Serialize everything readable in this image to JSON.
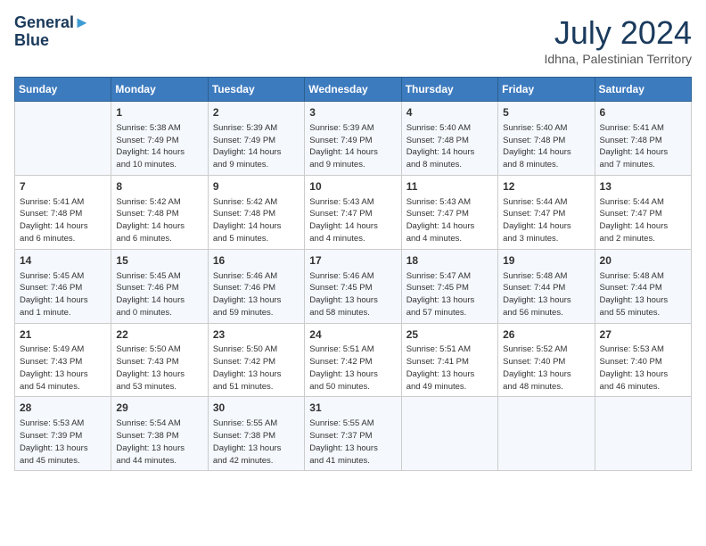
{
  "header": {
    "logo_line1": "General",
    "logo_line2": "Blue",
    "month_year": "July 2024",
    "location": "Idhna, Palestinian Territory"
  },
  "columns": [
    "Sunday",
    "Monday",
    "Tuesday",
    "Wednesday",
    "Thursday",
    "Friday",
    "Saturday"
  ],
  "weeks": [
    [
      {
        "day": "",
        "content": ""
      },
      {
        "day": "1",
        "content": "Sunrise: 5:38 AM\nSunset: 7:49 PM\nDaylight: 14 hours\nand 10 minutes."
      },
      {
        "day": "2",
        "content": "Sunrise: 5:39 AM\nSunset: 7:49 PM\nDaylight: 14 hours\nand 9 minutes."
      },
      {
        "day": "3",
        "content": "Sunrise: 5:39 AM\nSunset: 7:49 PM\nDaylight: 14 hours\nand 9 minutes."
      },
      {
        "day": "4",
        "content": "Sunrise: 5:40 AM\nSunset: 7:48 PM\nDaylight: 14 hours\nand 8 minutes."
      },
      {
        "day": "5",
        "content": "Sunrise: 5:40 AM\nSunset: 7:48 PM\nDaylight: 14 hours\nand 8 minutes."
      },
      {
        "day": "6",
        "content": "Sunrise: 5:41 AM\nSunset: 7:48 PM\nDaylight: 14 hours\nand 7 minutes."
      }
    ],
    [
      {
        "day": "7",
        "content": "Sunrise: 5:41 AM\nSunset: 7:48 PM\nDaylight: 14 hours\nand 6 minutes."
      },
      {
        "day": "8",
        "content": "Sunrise: 5:42 AM\nSunset: 7:48 PM\nDaylight: 14 hours\nand 6 minutes."
      },
      {
        "day": "9",
        "content": "Sunrise: 5:42 AM\nSunset: 7:48 PM\nDaylight: 14 hours\nand 5 minutes."
      },
      {
        "day": "10",
        "content": "Sunrise: 5:43 AM\nSunset: 7:47 PM\nDaylight: 14 hours\nand 4 minutes."
      },
      {
        "day": "11",
        "content": "Sunrise: 5:43 AM\nSunset: 7:47 PM\nDaylight: 14 hours\nand 4 minutes."
      },
      {
        "day": "12",
        "content": "Sunrise: 5:44 AM\nSunset: 7:47 PM\nDaylight: 14 hours\nand 3 minutes."
      },
      {
        "day": "13",
        "content": "Sunrise: 5:44 AM\nSunset: 7:47 PM\nDaylight: 14 hours\nand 2 minutes."
      }
    ],
    [
      {
        "day": "14",
        "content": "Sunrise: 5:45 AM\nSunset: 7:46 PM\nDaylight: 14 hours\nand 1 minute."
      },
      {
        "day": "15",
        "content": "Sunrise: 5:45 AM\nSunset: 7:46 PM\nDaylight: 14 hours\nand 0 minutes."
      },
      {
        "day": "16",
        "content": "Sunrise: 5:46 AM\nSunset: 7:46 PM\nDaylight: 13 hours\nand 59 minutes."
      },
      {
        "day": "17",
        "content": "Sunrise: 5:46 AM\nSunset: 7:45 PM\nDaylight: 13 hours\nand 58 minutes."
      },
      {
        "day": "18",
        "content": "Sunrise: 5:47 AM\nSunset: 7:45 PM\nDaylight: 13 hours\nand 57 minutes."
      },
      {
        "day": "19",
        "content": "Sunrise: 5:48 AM\nSunset: 7:44 PM\nDaylight: 13 hours\nand 56 minutes."
      },
      {
        "day": "20",
        "content": "Sunrise: 5:48 AM\nSunset: 7:44 PM\nDaylight: 13 hours\nand 55 minutes."
      }
    ],
    [
      {
        "day": "21",
        "content": "Sunrise: 5:49 AM\nSunset: 7:43 PM\nDaylight: 13 hours\nand 54 minutes."
      },
      {
        "day": "22",
        "content": "Sunrise: 5:50 AM\nSunset: 7:43 PM\nDaylight: 13 hours\nand 53 minutes."
      },
      {
        "day": "23",
        "content": "Sunrise: 5:50 AM\nSunset: 7:42 PM\nDaylight: 13 hours\nand 51 minutes."
      },
      {
        "day": "24",
        "content": "Sunrise: 5:51 AM\nSunset: 7:42 PM\nDaylight: 13 hours\nand 50 minutes."
      },
      {
        "day": "25",
        "content": "Sunrise: 5:51 AM\nSunset: 7:41 PM\nDaylight: 13 hours\nand 49 minutes."
      },
      {
        "day": "26",
        "content": "Sunrise: 5:52 AM\nSunset: 7:40 PM\nDaylight: 13 hours\nand 48 minutes."
      },
      {
        "day": "27",
        "content": "Sunrise: 5:53 AM\nSunset: 7:40 PM\nDaylight: 13 hours\nand 46 minutes."
      }
    ],
    [
      {
        "day": "28",
        "content": "Sunrise: 5:53 AM\nSunset: 7:39 PM\nDaylight: 13 hours\nand 45 minutes."
      },
      {
        "day": "29",
        "content": "Sunrise: 5:54 AM\nSunset: 7:38 PM\nDaylight: 13 hours\nand 44 minutes."
      },
      {
        "day": "30",
        "content": "Sunrise: 5:55 AM\nSunset: 7:38 PM\nDaylight: 13 hours\nand 42 minutes."
      },
      {
        "day": "31",
        "content": "Sunrise: 5:55 AM\nSunset: 7:37 PM\nDaylight: 13 hours\nand 41 minutes."
      },
      {
        "day": "",
        "content": ""
      },
      {
        "day": "",
        "content": ""
      },
      {
        "day": "",
        "content": ""
      }
    ]
  ]
}
